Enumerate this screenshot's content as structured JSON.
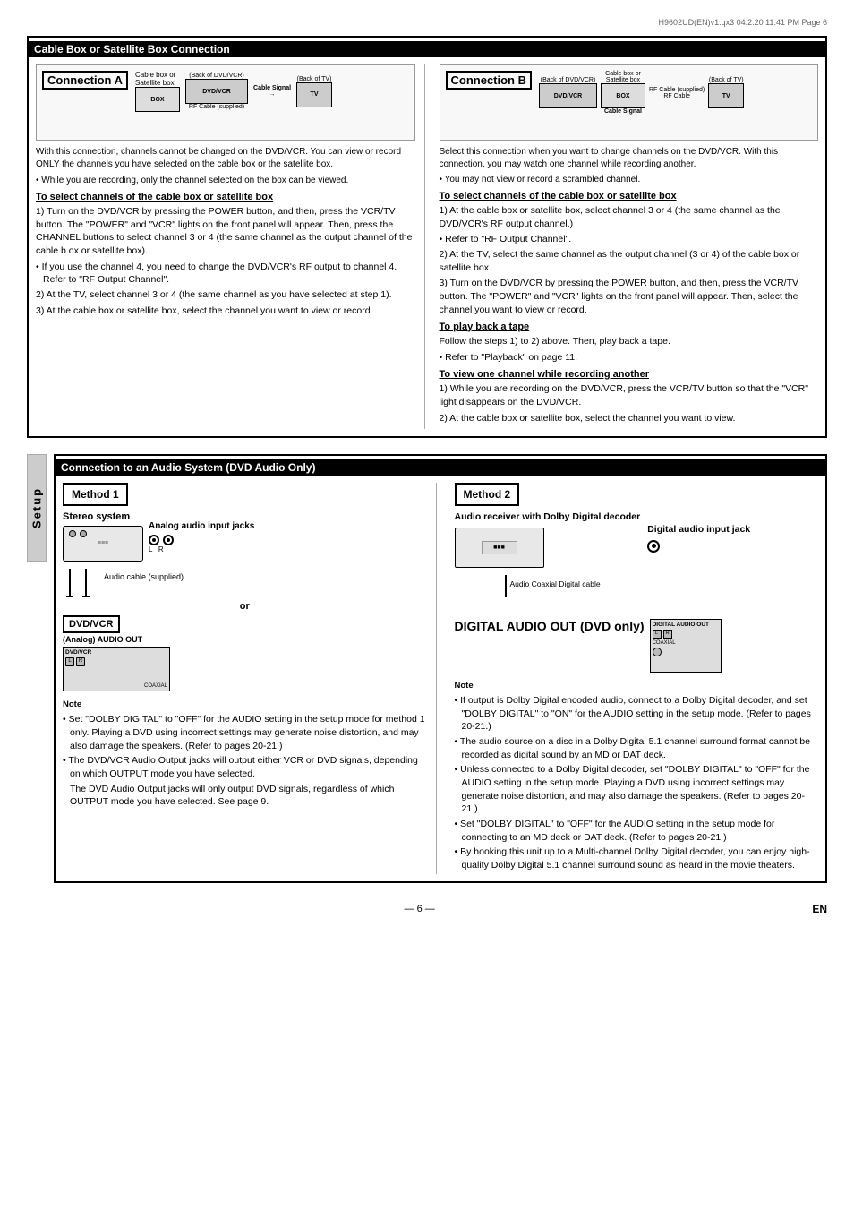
{
  "page_header": "H9602UD(EN)v1.qx3   04.2.20   11:41 PM   Page 6",
  "section1": {
    "title": "Cable Box or Satellite Box Connection",
    "left": {
      "conn_label": "Connection A",
      "diagram_labels": [
        "Cable box or Satellite box",
        "(Back of DVD/VCR)",
        "RF Cable (supplied)",
        "Cable Signal",
        "(Back of TV)"
      ],
      "intro": "With this connection, channels cannot be changed on the DVD/VCR. You can view or record ONLY the channels you have selected on the cable box or the satellite box.",
      "bullet1": "While you are recording, only the channel selected on the box can be viewed.",
      "subsection1_title": "To select channels of the cable box or satellite box",
      "steps_left": [
        "1) Turn on the DVD/VCR by pressing the POWER button, and then, press the VCR/TV button. The \"POWER\" and \"VCR\" lights on the front panel will appear. Then, press the CHANNEL buttons to select channel 3 or 4 (the same channel as the output channel of the cable b ox or satellite box).",
        "• If you use the channel 4, you need to change the DVD/VCR's RF output to channel 4. Refer to \"RF Output Channel\".",
        "2) At the TV, select channel 3 or 4 (the same channel as you have selected at step 1).",
        "3) At the cable box or satellite box, select the channel you want to view or record."
      ]
    },
    "right": {
      "conn_label": "Connection B",
      "diagram_labels": [
        "(Back of DVD/VCR)",
        "(Cable  box or Satellite box)",
        "Cable Signal",
        "RF Cable (supplied)",
        "RF Cable",
        "(Back of TV)"
      ],
      "intro": "Select this connection when you want to change channels on the DVD/VCR. With this connection, you may watch one channel while recording another.",
      "bullet1": "• You may not view or record a scrambled channel.",
      "subsection1_title": "To select channels of the cable box or satellite box",
      "steps_right": [
        "1) At the cable box or satellite box, select channel 3 or 4 (the same channel as the DVD/VCR's RF output channel.)",
        "• Refer to \"RF Output Channel\".",
        "2) At the TV, select the same channel as the output channel (3 or 4) of the cable box or satellite box.",
        "3) Turn on the DVD/VCR by pressing the POWER button, and then, press the VCR/TV button. The \"POWER\" and \"VCR\" lights on the front panel will appear. Then, select the channel you want to view or record."
      ],
      "playback_title": "To play back a tape",
      "playback_steps": [
        "Follow the steps 1) to 2) above. Then, play back a tape.",
        "• Refer to \"Playback\" on page 11."
      ],
      "view_title": "To view one channel while recording another",
      "view_steps": [
        "1) While you are recording on the DVD/VCR, press the VCR/TV button so that the \"VCR\" light disappears on the DVD/VCR.",
        "2) At the cable box or satellite box, select the channel you want to view."
      ]
    }
  },
  "sidebar_label": "Setup",
  "section2": {
    "title": "Connection to an Audio System (DVD Audio Only)",
    "method1": {
      "label": "Method 1",
      "device_label": "Stereo system",
      "jack_label": "Analog audio input jacks",
      "audio_label": "AUDIO",
      "cable_label": "Audio cable (supplied)",
      "or_text": "or",
      "dvdvcr_label": "DVD/VCR",
      "analog_out": "(Analog) AUDIO OUT"
    },
    "method2": {
      "label": "Method 2",
      "device_label": "Audio receiver with Dolby Digital decoder",
      "jack_label": "Digital audio input jack",
      "cable_label": "Audio Coaxial Digital cable",
      "digital_out": "DIGITAL AUDIO OUT (DVD only)"
    },
    "note_left": {
      "title": "Note",
      "bullets": [
        "• Set \"DOLBY DIGITAL\" to \"OFF\" for the AUDIO setting in the setup mode for method 1 only. Playing a DVD using incorrect settings may generate noise distortion, and may also damage the speakers. (Refer to pages 20-21.)",
        "• The DVD/VCR Audio Output jacks will output either VCR or DVD signals, depending on which OUTPUT mode you have selected.",
        "  The DVD Audio Output jacks will only output DVD signals, regardless of which OUTPUT mode you have selected. See page 9."
      ]
    },
    "note_right": {
      "title": "Note",
      "bullets": [
        "• If output is Dolby Digital encoded audio, connect to a Dolby Digital decoder, and set \"DOLBY DIGITAL\" to \"ON\" for the AUDIO setting in the setup mode. (Refer to pages 20-21.)",
        "• The audio source on a disc in a Dolby Digital 5.1 channel surround format cannot be recorded as digital sound by an MD or DAT deck.",
        "• Unless connected to a Dolby Digital decoder, set \"DOLBY DIGITAL\" to \"OFF\" for the AUDIO setting in the setup mode. Playing a DVD using incorrect settings may generate noise distortion, and may also damage the speakers. (Refer to pages 20-21.)",
        "• Set \"DOLBY DIGITAL\" to \"OFF\" for the AUDIO setting in the setup mode for connecting to an MD deck or DAT deck. (Refer to pages 20-21.)",
        "• By hooking this unit up to a Multi-channel Dolby Digital decoder, you can enjoy high-quality Dolby Digital 5.1 channel  surround sound as heard in the movie theaters."
      ]
    }
  },
  "page_bottom": {
    "number": "— 6 —",
    "lang": "EN"
  }
}
